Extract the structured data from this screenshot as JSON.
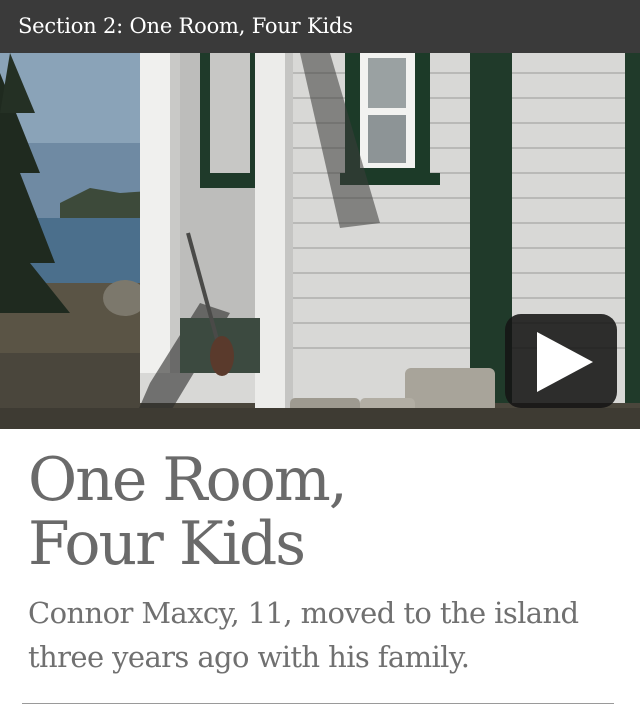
{
  "header": {
    "section_title": "Section 2: One Room, Four Kids"
  },
  "video": {
    "play_icon": "play-icon",
    "overlay_color": "#141414"
  },
  "article": {
    "title_line1": "One Room,",
    "title_line2": "Four Kids",
    "subtitle": "Connor Maxcy, 11, moved to the island three years ago with his family."
  },
  "colors": {
    "header_bg": "#3a3a3a",
    "title_text": "#6a6a6a",
    "subtitle_text": "#707070"
  }
}
